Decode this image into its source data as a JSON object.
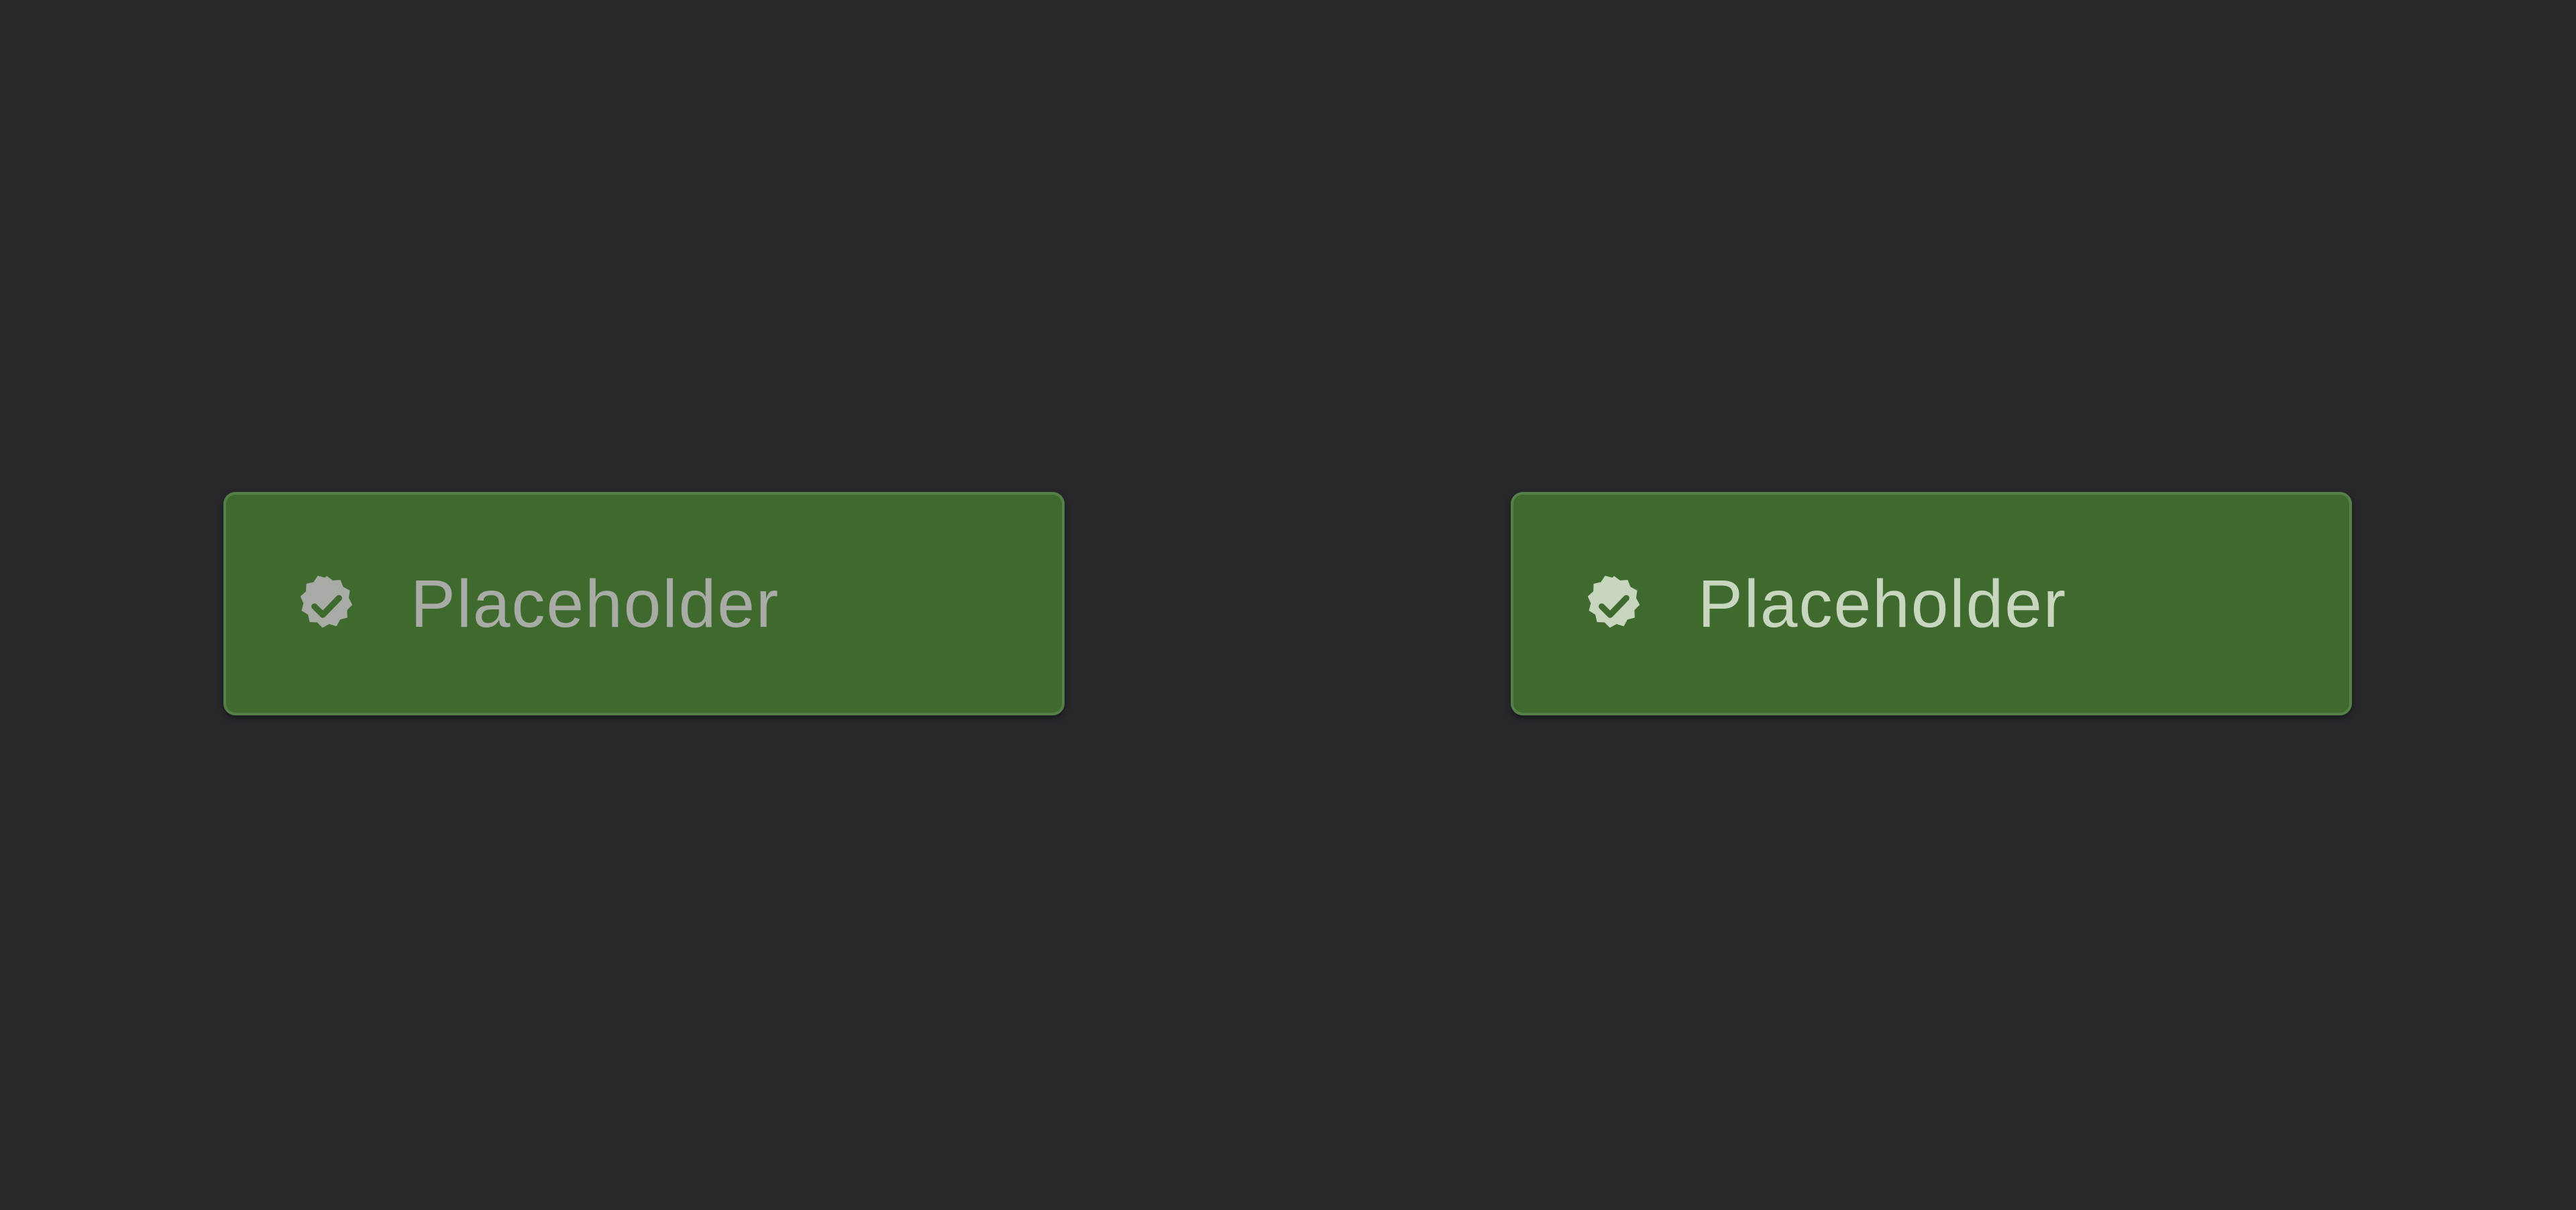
{
  "chips": [
    {
      "label": "Placeholder",
      "icon": "verified-badge-icon",
      "state": "disabled",
      "text_color": "#a9aba6",
      "icon_color": "#a9aba6"
    },
    {
      "label": "Placeholder",
      "icon": "verified-badge-icon",
      "state": "enabled",
      "text_color": "#c8d6c0",
      "icon_color": "#c8d6c0"
    }
  ],
  "colors": {
    "background": "#28272c",
    "chip_fill": "#3e6a2d",
    "chip_border": "#56804a",
    "check_mark": "#3e6a2d"
  }
}
